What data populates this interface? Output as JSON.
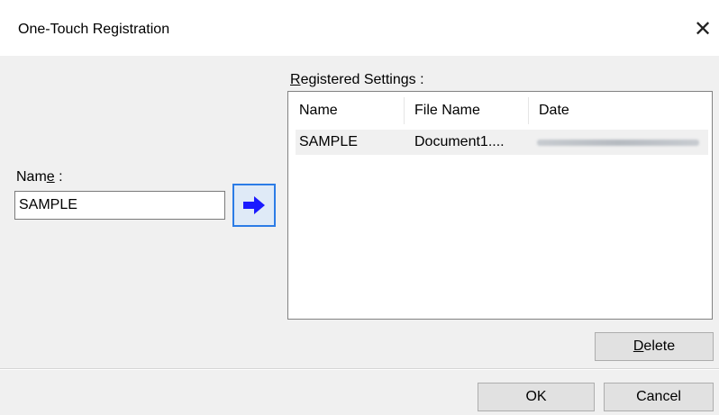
{
  "window": {
    "title": "One-Touch Registration",
    "close_glyph": "✕"
  },
  "name_field": {
    "label_prefix": "Nam",
    "label_mnemonic": "e",
    "label_suffix": " :",
    "value": "SAMPLE"
  },
  "arrow_button": {
    "icon": "right-arrow-icon",
    "color": "#1a1aff"
  },
  "registered": {
    "label_mnemonic": "R",
    "label_rest": "egistered Settings :",
    "columns": [
      "Name",
      "File Name",
      "Date"
    ],
    "rows": [
      {
        "name": "SAMPLE",
        "file_name": "Document1...."
      }
    ]
  },
  "buttons": {
    "delete_mnemonic": "D",
    "delete_rest": "elete",
    "ok": "OK",
    "cancel": "Cancel"
  }
}
